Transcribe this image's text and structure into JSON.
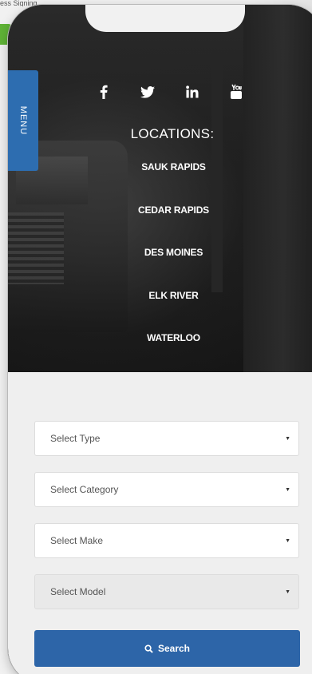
{
  "background_page": {
    "top_text": "ess Signing..."
  },
  "menu_tab": {
    "label": "MENU"
  },
  "social": {
    "icons": [
      "facebook-icon",
      "twitter-icon",
      "linkedin-icon",
      "youtube-icon"
    ]
  },
  "locations": {
    "title": "LOCATIONS:",
    "items": [
      "SAUK RAPIDS",
      "CEDAR RAPIDS",
      "DES MOINES",
      "ELK RIVER",
      "WATERLOO"
    ]
  },
  "form": {
    "type_select": "Select Type",
    "category_select": "Select Category",
    "make_select": "Select Make",
    "model_select": "Select Model",
    "caret": "▼",
    "search_label": "Search"
  },
  "colors": {
    "menu_tab": "#2d6db0",
    "search_button": "#2d65a8",
    "form_background": "#efefef"
  }
}
